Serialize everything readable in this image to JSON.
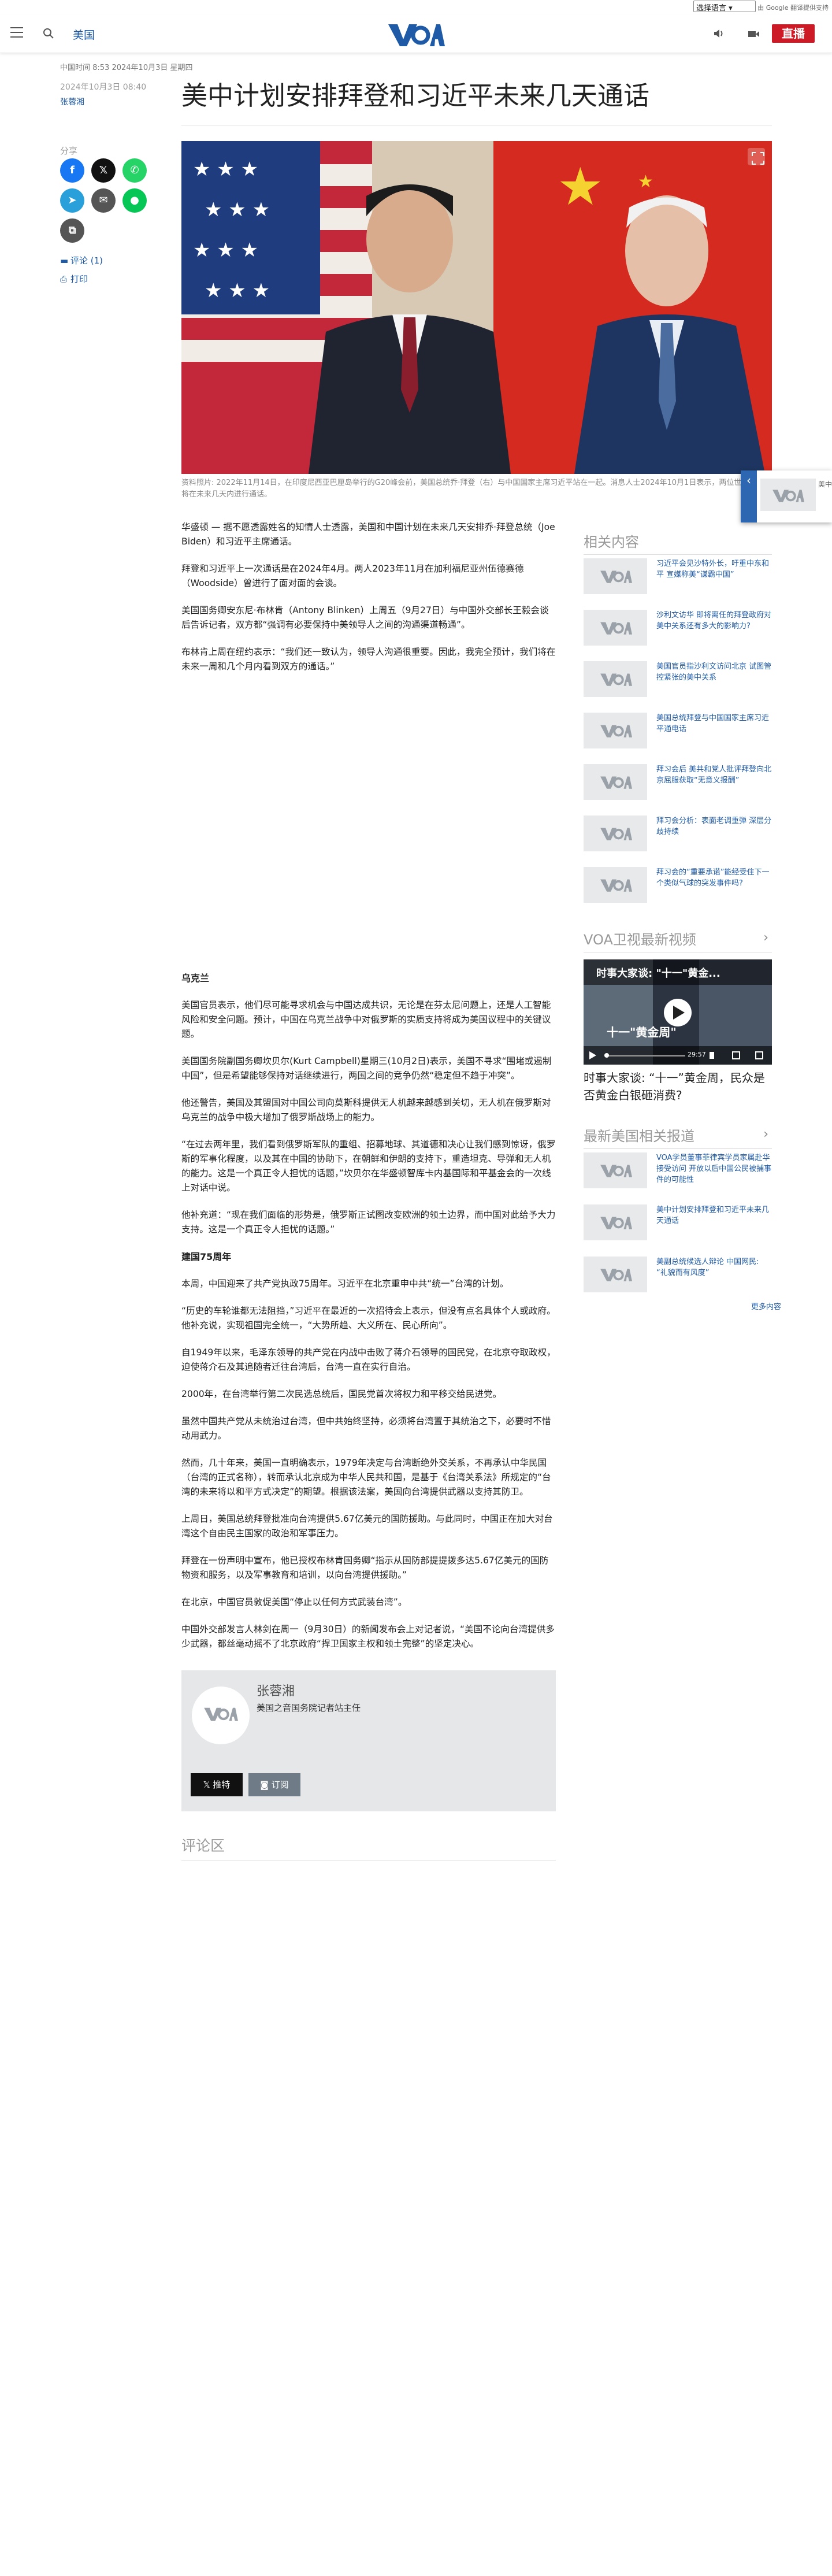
{
  "translate": {
    "select_label": "选择语言",
    "powered": "由 Google 翻译提供支持"
  },
  "header": {
    "section": "美国",
    "live": "直播"
  },
  "dateline": "中国时间 8:53 2024年10月3日 星期四",
  "article": {
    "date": "2024年10月3日 08:40",
    "author": "张蓉湘",
    "title": "美中计划安排拜登和习近平未来几天通话",
    "caption": "资料照片: 2022年11月14日，在印度尼西亚巴厘岛举行的G20峰会前，美国总统乔·拜登（右）与中国国家主席习近平站在一起。消息人士2024年10月1日表示，两位世界领导人将在未来几天内进行通话。",
    "paragraphs_a": [
      "华盛顿 — 据不愿透露姓名的知情人士透露，美国和中国计划在未来几天安排乔·拜登总统（Joe Biden）和习近平主席通话。",
      "拜登和习近平上一次通话是在2024年4月。两人2023年11月在加利福尼亚州伍德赛德（Woodside）曾进行了面对面的会谈。",
      "美国国务卿安东尼·布林肯（Antony Blinken）上周五（9月27日）与中国外交部长王毅会谈后告诉记者，双方都“强调有必要保持中美领导人之间的沟通渠道畅通”。",
      "布林肯上周在纽约表示：“我们还一致认为，领导人沟通很重要。因此，我完全预计，我们将在未来一周和几个月内看到双方的通话。”"
    ],
    "subhead_1": "乌克兰",
    "paragraphs_b": [
      "美国官员表示，他们尽可能寻求机会与中国达成共识，无论是在芬太尼问题上，还是人工智能风险和安全问题。预计，中国在乌克兰战争中对俄罗斯的实质支持将成为美国议程中的关键议题。",
      "美国国务院副国务卿坎贝尔(Kurt Campbell)星期三(10月2日)表示，美国不寻求“围堵或遏制中国”，但是希望能够保持对话继续进行，两国之间的竞争仍然“稳定但不趋于冲突”。",
      "他还警告，美国及其盟国对中国公司向莫斯科提供无人机越来越感到关切，无人机在俄罗斯对乌克兰的战争中极大增加了俄罗斯战场上的能力。",
      "“在过去两年里，我们看到俄罗斯军队的重组、招募地球、其道德和决心让我们感到惊讶，俄罗斯的军事化程度，以及其在中国的协助下，在朝鲜和伊朗的支持下，重造坦克、导弹和无人机的能力。这是一个真正令人担忧的话题，”坎贝尔在华盛顿智库卡内基国际和平基金会的一次线上对话中说。",
      "他补充道：“现在我们面临的形势是，俄罗斯正试图改变欧洲的领土边界，而中国对此给予大力支持。这是一个真正令人担忧的话题。”"
    ],
    "subhead_2": "建国75周年",
    "paragraphs_c": [
      "本周，中国迎来了共产党执政75周年。习近平在北京重申中共“统一”台湾的计划。",
      "“历史的车轮谁都无法阻挡，”习近平在最近的一次招待会上表示，但没有点名具体个人或政府。他补充说，实现祖国完全统一，“大势所趋、大义所在、民心所向”。",
      "自1949年以来，毛泽东领导的共产党在内战中击败了蒋介石领导的国民党，在北京夺取政权，迫使蒋介石及其追随者迁往台湾后，台湾一直在实行自治。",
      "2000年，在台湾举行第二次民选总统后，国民党首次将权力和平移交给民进党。",
      "虽然中国共产党从未统治过台湾，但中共始终坚持，必须将台湾置于其统治之下，必要时不惜动用武力。",
      "然而，几十年来，美国一直明确表示，1979年决定与台湾断绝外交关系，不再承认中华民国（台湾的正式名称），转而承认北京成为中华人民共和国，是基于《台湾关系法》所规定的“台湾的未来将以和平方式决定”的期望。根据该法案，美国向台湾提供武器以支持其防卫。",
      "上周日，美国总统拜登批准向台湾提供5.67亿美元的国防援助。与此同时，中国正在加大对台湾这个自由民主国家的政治和军事压力。",
      "拜登在一份声明中宣布，他已授权布林肯国务卿“指示从国防部提提拨多达5.67亿美元的国防物资和服务，以及军事教育和培训，以向台湾提供援助。”",
      "在北京，中国官员敦促美国“停止以任何方式武装台湾”。",
      "中国外交部发言人林剑在周一（9月30日）的新闻发布会上对记者说，“美国不论向台湾提供多少武器，都丝毫动摇不了北京政府“捍卫国家主权和领土完整”的坚定决心。"
    ]
  },
  "share": {
    "label": "分享",
    "comments_link": "评论 (1)",
    "print_link": "打印"
  },
  "author_box": {
    "name": "张蓉湘",
    "role": "美国之音国务院记者站主任",
    "follow": "推特",
    "rss": "订阅"
  },
  "comments_heading": "评论区",
  "sidebar": {
    "related_heading": "相关内容",
    "related": [
      "习近平会见沙特外长，吁重中东和平 宣媒称美“谋霸中国”",
      "沙利文访华 即将离任的拜登政府对美中关系还有多大的影响力?",
      "美国官员指沙利文访问北京 试图管控紧张的美中关系",
      "美国总统拜登与中国国家主席习近平通电话",
      "拜习会后 美共和党人批评拜登向北京屈服获取“无意义报酬”",
      "拜习会分析：表面老调重弹 深层分歧持续",
      "拜习会的“重要承诺”能经受住下一个类似气球的突发事件吗?"
    ],
    "video_heading": "VOA卫视最新视频",
    "video_overlay_title": "时事大家谈: \"十一\"黄金...",
    "video_overlay_sub": "十一\"黄金周\"",
    "video_time": "29:57",
    "video_caption": "时事大家谈: “十一”黄金周，民众是否黄金白银砸消费?",
    "latest_heading": "最新美国相关报道",
    "latest": [
      "VOA学员董事菲律宾学员家属赴华接受访问 开放以后中国公民被捕事件的可能性",
      "美中计划安排拜登和习近平未来几天通话",
      "美副总统候选人辩论 中国网民: “礼貌而有风度”"
    ],
    "more": "更多内容"
  },
  "float_widget": {
    "text": "美中计划安排拜登和"
  },
  "colors": {
    "brand_blue": "#1e5aa6",
    "live_red": "#cc1b27"
  }
}
